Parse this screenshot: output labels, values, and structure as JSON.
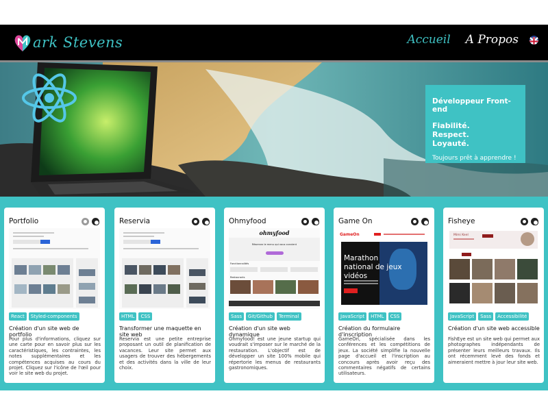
{
  "header": {
    "logo_text": "ark Stevens",
    "nav": {
      "home_label": "Accueil",
      "about_label": "A Propos"
    },
    "language_flag": "uk-flag-icon"
  },
  "hero": {
    "role": "Développeur Front-end",
    "qualities": [
      "Fiabilité.",
      "Respect.",
      "Loyauté."
    ],
    "tagline": "Toujours prêt à apprendre !"
  },
  "projects": [
    {
      "title": "Portfolio",
      "tags": [
        "React",
        "Styled-components"
      ],
      "subtitle": "Création d'un site web de portfolio",
      "description": "Pour plus d'informations, cliquez sur une carte pour en savoir plus sur les caractéristiques, les contraintes, les notes supplémentaires et les compétences acquises au cours du projet. Cliquez sur l'icône de l'œil pour voir le site web du projet."
    },
    {
      "title": "Reservia",
      "tags": [
        "HTML",
        "CSS"
      ],
      "subtitle": "Transformer une maquette en site web",
      "description": "Reservia est une petite entreprise proposant un outil de planification de vacances. Leur site permet aux usagers de trouver des hébergements et des activités dans la ville de leur choix."
    },
    {
      "title": "Ohmyfood",
      "tags": [
        "Sass",
        "Git/Github",
        "Terminal"
      ],
      "subtitle": "Création d'un site web dynamique",
      "description": "Ohmyfood! est une jeune startup qui voudrait s'imposer sur le marché de la restauration. L'objectif est de développer un site 100% mobile qui répertorie les menus de restaurants gastronomiques."
    },
    {
      "title": "Game On",
      "tags": [
        "JavaScript",
        "HTML",
        "CSS"
      ],
      "subtitle": "Création du formulaire d'inscription",
      "description": "GameOn, spécialisée dans les conférences et les compétitions de jeux. La société simplifie la nouvelle page d'accueil et l'inscription au concours après avoir reçu des commentaires négatifs de certains utilisateurs."
    },
    {
      "title": "Fisheye",
      "tags": [
        "JavaScript",
        "Sass",
        "Accessibilité"
      ],
      "subtitle": "Création d'un site web accessible",
      "description": "FishEye est un site web qui permet aux photographes indépendants de présenter leurs meilleurs travaux. Ils ont récemment levé des fonds et aimeraient mettre à jour leur site web."
    }
  ],
  "thumbs": {
    "ohmyfood_logo": "ohmyfood",
    "ohmyfood_heading": "Réservez le menu qui vous convient",
    "ohmyfood_features": "Fonctionnalités",
    "ohmyfood_restaurants": "Restaurants",
    "gameon_logo": "GameOn",
    "gameon_title": "Marathon national de jeux vidéos",
    "fisheye_name": "Mimi Keel"
  },
  "colors": {
    "accent": "#3fc2c4",
    "header_bg": "#000000"
  }
}
